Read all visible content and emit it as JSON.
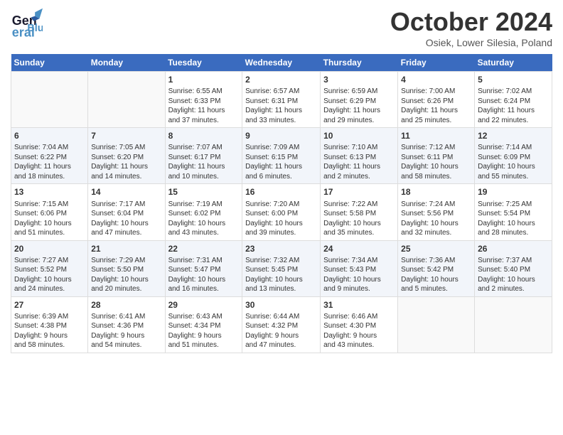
{
  "header": {
    "logo_general": "General",
    "logo_blue": "Blue",
    "month_title": "October 2024",
    "location": "Osiek, Lower Silesia, Poland"
  },
  "weekdays": [
    "Sunday",
    "Monday",
    "Tuesday",
    "Wednesday",
    "Thursday",
    "Friday",
    "Saturday"
  ],
  "weeks": [
    [
      {
        "day": "",
        "info": ""
      },
      {
        "day": "",
        "info": ""
      },
      {
        "day": "1",
        "info": "Sunrise: 6:55 AM\nSunset: 6:33 PM\nDaylight: 11 hours\nand 37 minutes."
      },
      {
        "day": "2",
        "info": "Sunrise: 6:57 AM\nSunset: 6:31 PM\nDaylight: 11 hours\nand 33 minutes."
      },
      {
        "day": "3",
        "info": "Sunrise: 6:59 AM\nSunset: 6:29 PM\nDaylight: 11 hours\nand 29 minutes."
      },
      {
        "day": "4",
        "info": "Sunrise: 7:00 AM\nSunset: 6:26 PM\nDaylight: 11 hours\nand 25 minutes."
      },
      {
        "day": "5",
        "info": "Sunrise: 7:02 AM\nSunset: 6:24 PM\nDaylight: 11 hours\nand 22 minutes."
      }
    ],
    [
      {
        "day": "6",
        "info": "Sunrise: 7:04 AM\nSunset: 6:22 PM\nDaylight: 11 hours\nand 18 minutes."
      },
      {
        "day": "7",
        "info": "Sunrise: 7:05 AM\nSunset: 6:20 PM\nDaylight: 11 hours\nand 14 minutes."
      },
      {
        "day": "8",
        "info": "Sunrise: 7:07 AM\nSunset: 6:17 PM\nDaylight: 11 hours\nand 10 minutes."
      },
      {
        "day": "9",
        "info": "Sunrise: 7:09 AM\nSunset: 6:15 PM\nDaylight: 11 hours\nand 6 minutes."
      },
      {
        "day": "10",
        "info": "Sunrise: 7:10 AM\nSunset: 6:13 PM\nDaylight: 11 hours\nand 2 minutes."
      },
      {
        "day": "11",
        "info": "Sunrise: 7:12 AM\nSunset: 6:11 PM\nDaylight: 10 hours\nand 58 minutes."
      },
      {
        "day": "12",
        "info": "Sunrise: 7:14 AM\nSunset: 6:09 PM\nDaylight: 10 hours\nand 55 minutes."
      }
    ],
    [
      {
        "day": "13",
        "info": "Sunrise: 7:15 AM\nSunset: 6:06 PM\nDaylight: 10 hours\nand 51 minutes."
      },
      {
        "day": "14",
        "info": "Sunrise: 7:17 AM\nSunset: 6:04 PM\nDaylight: 10 hours\nand 47 minutes."
      },
      {
        "day": "15",
        "info": "Sunrise: 7:19 AM\nSunset: 6:02 PM\nDaylight: 10 hours\nand 43 minutes."
      },
      {
        "day": "16",
        "info": "Sunrise: 7:20 AM\nSunset: 6:00 PM\nDaylight: 10 hours\nand 39 minutes."
      },
      {
        "day": "17",
        "info": "Sunrise: 7:22 AM\nSunset: 5:58 PM\nDaylight: 10 hours\nand 35 minutes."
      },
      {
        "day": "18",
        "info": "Sunrise: 7:24 AM\nSunset: 5:56 PM\nDaylight: 10 hours\nand 32 minutes."
      },
      {
        "day": "19",
        "info": "Sunrise: 7:25 AM\nSunset: 5:54 PM\nDaylight: 10 hours\nand 28 minutes."
      }
    ],
    [
      {
        "day": "20",
        "info": "Sunrise: 7:27 AM\nSunset: 5:52 PM\nDaylight: 10 hours\nand 24 minutes."
      },
      {
        "day": "21",
        "info": "Sunrise: 7:29 AM\nSunset: 5:50 PM\nDaylight: 10 hours\nand 20 minutes."
      },
      {
        "day": "22",
        "info": "Sunrise: 7:31 AM\nSunset: 5:47 PM\nDaylight: 10 hours\nand 16 minutes."
      },
      {
        "day": "23",
        "info": "Sunrise: 7:32 AM\nSunset: 5:45 PM\nDaylight: 10 hours\nand 13 minutes."
      },
      {
        "day": "24",
        "info": "Sunrise: 7:34 AM\nSunset: 5:43 PM\nDaylight: 10 hours\nand 9 minutes."
      },
      {
        "day": "25",
        "info": "Sunrise: 7:36 AM\nSunset: 5:42 PM\nDaylight: 10 hours\nand 5 minutes."
      },
      {
        "day": "26",
        "info": "Sunrise: 7:37 AM\nSunset: 5:40 PM\nDaylight: 10 hours\nand 2 minutes."
      }
    ],
    [
      {
        "day": "27",
        "info": "Sunrise: 6:39 AM\nSunset: 4:38 PM\nDaylight: 9 hours\nand 58 minutes."
      },
      {
        "day": "28",
        "info": "Sunrise: 6:41 AM\nSunset: 4:36 PM\nDaylight: 9 hours\nand 54 minutes."
      },
      {
        "day": "29",
        "info": "Sunrise: 6:43 AM\nSunset: 4:34 PM\nDaylight: 9 hours\nand 51 minutes."
      },
      {
        "day": "30",
        "info": "Sunrise: 6:44 AM\nSunset: 4:32 PM\nDaylight: 9 hours\nand 47 minutes."
      },
      {
        "day": "31",
        "info": "Sunrise: 6:46 AM\nSunset: 4:30 PM\nDaylight: 9 hours\nand 43 minutes."
      },
      {
        "day": "",
        "info": ""
      },
      {
        "day": "",
        "info": ""
      }
    ]
  ]
}
